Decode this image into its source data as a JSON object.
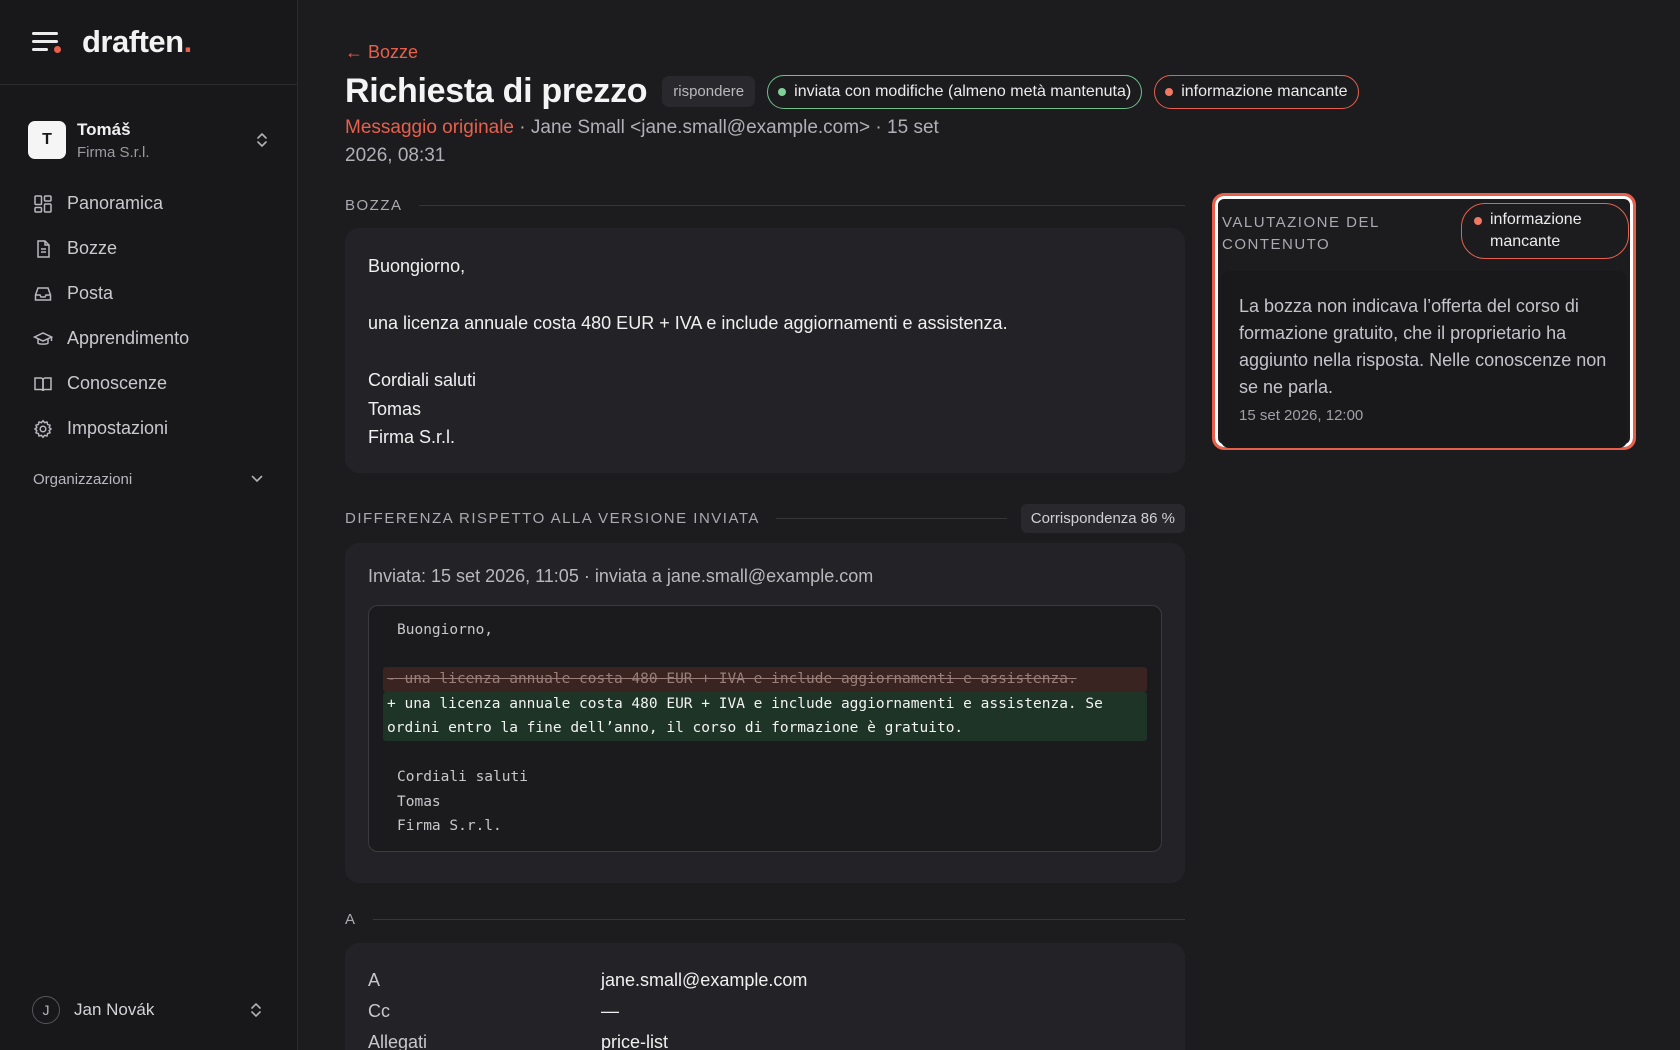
{
  "brand": {
    "name": "draften",
    "accent": "."
  },
  "account": {
    "initial": "T",
    "name": "Tomáš",
    "org": "Firma S.r.l."
  },
  "nav": [
    {
      "label": "Panoramica",
      "icon": "dashboard-icon"
    },
    {
      "label": "Bozze",
      "icon": "document-icon"
    },
    {
      "label": "Posta",
      "icon": "inbox-icon"
    },
    {
      "label": "Apprendimento",
      "icon": "graduation-cap-icon"
    },
    {
      "label": "Conoscenze",
      "icon": "book-icon"
    },
    {
      "label": "Impostazioni",
      "icon": "gear-icon"
    }
  ],
  "organizations": {
    "label": "Organizzazioni"
  },
  "user": {
    "initial": "J",
    "name": "Jan Novák"
  },
  "header": {
    "back_label": "← Bozze",
    "title": "Richiesta di prezzo",
    "type_tag": "rispondere",
    "status_pill": "inviata con modifiche (almeno metà mantenuta)",
    "issue_pill": "informazione mancante",
    "original_link": "Messaggio originale",
    "meta": " · Jane Small <jane.small@example.com> · 15 set 2026, 08:31"
  },
  "draft": {
    "section_title": "BOZZA",
    "lines": [
      "Buongiorno,",
      "",
      "una licenza annuale costa 480 EUR + IVA e include aggiornamenti e assistenza.",
      "",
      "Cordiali saluti",
      "Tomas",
      "Firma S.r.l."
    ]
  },
  "diff": {
    "section_title": "DIFFERENZA RISPETTO ALLA VERSIONE INVIATA",
    "match_badge": "Corrispondenza 86 %",
    "sent_line": "Inviata: 15 set 2026, 11:05 · inviata a jane.small@example.com",
    "lines": [
      {
        "type": "same",
        "text": "Buongiorno,"
      },
      {
        "type": "same",
        "text": ""
      },
      {
        "type": "del",
        "text": "- una licenza annuale costa 480 EUR + IVA e include aggiornamenti e assistenza."
      },
      {
        "type": "add",
        "text": "+ una licenza annuale costa 480 EUR + IVA e include aggiornamenti e assistenza. Se ordini entro la fine dell’anno, il corso di formazione è gratuito."
      },
      {
        "type": "same",
        "text": ""
      },
      {
        "type": "same",
        "text": "Cordiali saluti"
      },
      {
        "type": "same",
        "text": "Tomas"
      },
      {
        "type": "same",
        "text": "Firma S.r.l."
      }
    ]
  },
  "recipients": {
    "section_title": "A",
    "rows": [
      {
        "key": "A",
        "value": "jane.small@example.com"
      },
      {
        "key": "Cc",
        "value": "—"
      },
      {
        "key": "Allegati",
        "value": "price-list"
      }
    ]
  },
  "evaluation": {
    "title": "VALUTAZIONE DEL CONTENUTO",
    "pill": "informazione mancante",
    "text": "La bozza non indicava l’offerta del corso di formazione gratuito, che il proprietario ha aggiunto nella risposta. Nelle conoscenze non se ne parla.",
    "date": "15 set 2026, 12:00"
  },
  "colors": {
    "accent": "#e8604c",
    "success": "#7fcf99",
    "background": "#1c1c1f",
    "sidebar": "#18181b",
    "card": "#232327"
  }
}
